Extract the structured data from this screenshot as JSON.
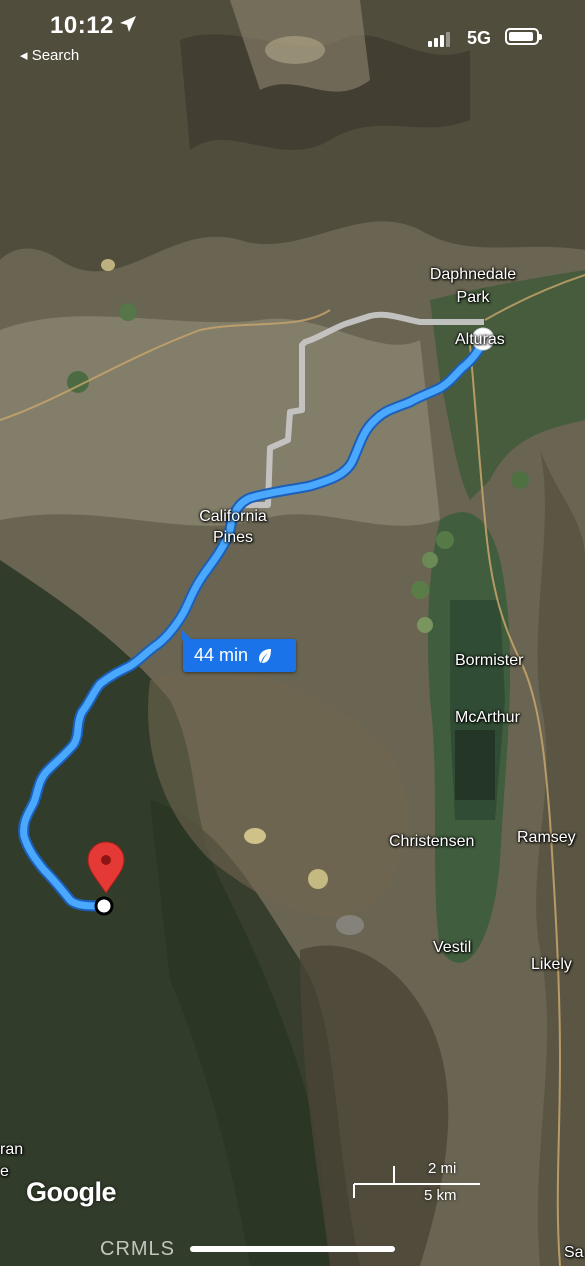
{
  "status_bar": {
    "time": "10:12",
    "back_label": "◂ Search",
    "network": "5G"
  },
  "map": {
    "places": {
      "daphnedale_1": "Daphnedale",
      "daphnedale_2": "Park",
      "alturas": "Alturas",
      "california_pines_1": "California",
      "california_pines_2": "Pines",
      "bormister": "Bormister",
      "mcarthur": "McArthur",
      "christensen": "Christensen",
      "ramsey": "Ramsey",
      "vestil": "Vestil",
      "likely": "Likely",
      "edge_left_1": "ran",
      "edge_left_2": "e",
      "edge_bottom_right": "Sa"
    },
    "route": {
      "duration": "44 min",
      "eco_icon": "leaf-icon",
      "color": "#4aa8ff",
      "alt_color": "#c6c6c6"
    },
    "destination_pin": {
      "icon": "map-pin-icon",
      "color": "#e53935"
    },
    "origin_marker": {
      "icon": "origin-dot-icon"
    },
    "scale": {
      "imperial": "2 mi",
      "metric": "5 km"
    },
    "attribution": "Google",
    "watermark": "CRMLS"
  }
}
